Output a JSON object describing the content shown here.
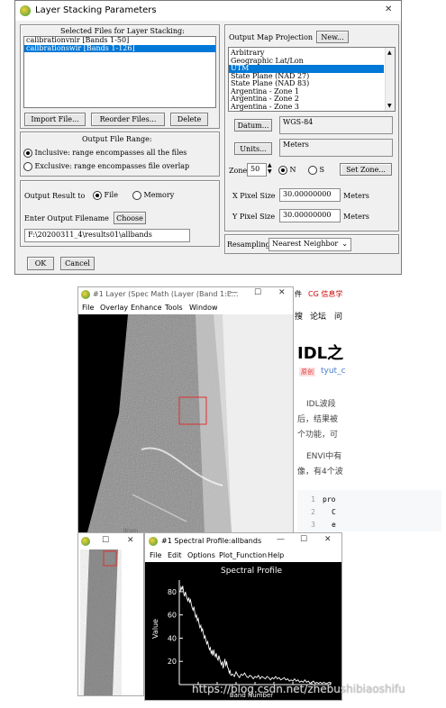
{
  "layer_dialog": {
    "title": "Layer Stacking Parameters",
    "close": "✕",
    "selected_files_label": "Selected Files for Layer Stacking:",
    "files": [
      "calibrationvnir [Bands 1-50]",
      "calibrationswir [Bands 1-126]"
    ],
    "import_btn": "Import File...",
    "reorder_btn": "Reorder Files...",
    "delete_btn": "Delete",
    "range_label": "Output File Range:",
    "inclusive": "Inclusive: range encompasses all the files",
    "exclusive": "Exclusive: range encompasses file overlap",
    "output_result_to": "Output Result to",
    "file_opt": "File",
    "memory_opt": "Memory",
    "filename_label": "Enter Output Filename",
    "choose_btn": "Choose",
    "filename_value": "F:\\20200311_4\\results01\\allbands",
    "ok_btn": "OK",
    "cancel_btn": "Cancel",
    "projection_label": "Output Map Projection",
    "new_btn": "New...",
    "projections": [
      "Arbitrary",
      "Geographic Lat/Lon",
      "UTM",
      "State Plane (NAD 27)",
      "State Plane (NAD 83)",
      "Argentina - Zone 1",
      "Argentina - Zone 2",
      "Argentina - Zone 3"
    ],
    "selected_projection": "UTM",
    "datum_btn": "Datum...",
    "datum_value": "WGS-84",
    "units_btn": "Units...",
    "units_value": "Meters",
    "zone_label": "Zone",
    "zone_value": "50",
    "n_opt": "N",
    "s_opt": "S",
    "set_zone_btn": "Set Zone...",
    "xpixel_label": "X Pixel Size",
    "xpixel_value": "30.00000000",
    "ypixel_label": "Y Pixel Size",
    "ypixel_value": "30.00000000",
    "meters": "Meters",
    "resampling_label": "Resampling",
    "resampling_value": "Nearest Neighbor"
  },
  "image_window": {
    "title": "#1 Layer (Spec Math (Layer (Band 1:E...",
    "menus": [
      "File",
      "Overlay",
      "Enhance",
      "Tools",
      "Window"
    ],
    "minimize": "—",
    "maximize": "☐",
    "close": "✕"
  },
  "bg_page": {
    "top_partial": "件",
    "cg": "CG 信息学",
    "nav_tail": "搜",
    "nav": [
      "论坛",
      "问"
    ],
    "heading": "IDL之",
    "tag": "原创",
    "author": "tyut_c",
    "para1": [
      "IDL波段",
      "后，结果被",
      "个功能，可"
    ],
    "para2": [
      "ENVI中有",
      "像，有4个波"
    ],
    "code_lines": [
      {
        "n": "1",
        "t": "pro"
      },
      {
        "n": "2",
        "t": "C"
      },
      {
        "n": "3",
        "t": "e"
      }
    ]
  },
  "scroll_window": {
    "title_partial": "",
    "max": "☐",
    "close": "✕",
    "label_partial": "itrum"
  },
  "spectral_window": {
    "title": "#1 Spectral Profile:allbands",
    "minimize": "—",
    "maximize": "☐",
    "close": "✕",
    "menus": [
      "File",
      "Edit",
      "Options",
      "Plot_Function",
      "Help"
    ]
  },
  "chart_data": {
    "type": "line",
    "title": "Spectral Profile",
    "xlabel": "Band Number",
    "ylabel": "Value",
    "yticks": [
      20,
      40,
      60,
      80
    ],
    "xticks": [],
    "ylim": [
      0,
      90
    ],
    "xlim": [
      0,
      176
    ],
    "series": [
      {
        "values": [
          [
            1,
            80
          ],
          [
            2,
            84
          ],
          [
            3,
            82
          ],
          [
            4,
            85
          ],
          [
            5,
            79
          ],
          [
            6,
            76
          ],
          [
            7,
            80
          ],
          [
            8,
            77
          ],
          [
            9,
            74
          ],
          [
            10,
            72
          ],
          [
            11,
            75
          ],
          [
            12,
            71
          ],
          [
            13,
            73
          ],
          [
            14,
            69
          ],
          [
            15,
            66
          ],
          [
            16,
            64
          ],
          [
            17,
            67
          ],
          [
            18,
            62
          ],
          [
            19,
            58
          ],
          [
            20,
            60
          ],
          [
            21,
            55
          ],
          [
            22,
            57
          ],
          [
            23,
            52
          ],
          [
            24,
            49
          ],
          [
            25,
            51
          ],
          [
            26,
            46
          ],
          [
            27,
            48
          ],
          [
            28,
            44
          ],
          [
            29,
            40
          ],
          [
            30,
            42
          ],
          [
            31,
            38
          ],
          [
            32,
            35
          ],
          [
            33,
            37
          ],
          [
            34,
            33
          ],
          [
            35,
            30
          ],
          [
            36,
            32
          ],
          [
            37,
            27
          ],
          [
            38,
            29
          ],
          [
            39,
            25
          ],
          [
            40,
            30
          ],
          [
            41,
            26
          ],
          [
            42,
            24
          ],
          [
            43,
            27
          ],
          [
            44,
            23
          ],
          [
            45,
            21
          ],
          [
            46,
            25
          ],
          [
            47,
            22
          ],
          [
            48,
            19
          ],
          [
            49,
            17
          ],
          [
            50,
            20
          ],
          [
            51,
            14
          ],
          [
            52,
            18
          ],
          [
            53,
            22
          ],
          [
            54,
            16
          ],
          [
            55,
            20
          ],
          [
            56,
            15
          ],
          [
            57,
            14
          ],
          [
            58,
            10
          ],
          [
            59,
            12
          ],
          [
            60,
            8
          ],
          [
            62,
            9
          ],
          [
            64,
            7
          ],
          [
            66,
            11
          ],
          [
            68,
            8
          ],
          [
            70,
            6
          ],
          [
            72,
            9
          ],
          [
            74,
            8
          ],
          [
            76,
            10
          ],
          [
            78,
            7
          ],
          [
            80,
            6
          ],
          [
            82,
            8
          ],
          [
            84,
            7
          ],
          [
            86,
            5
          ],
          [
            88,
            7
          ],
          [
            90,
            6
          ],
          [
            92,
            8
          ],
          [
            94,
            5
          ],
          [
            96,
            7
          ],
          [
            98,
            6
          ],
          [
            100,
            5
          ],
          [
            102,
            7
          ],
          [
            104,
            6
          ],
          [
            106,
            4
          ],
          [
            108,
            6
          ],
          [
            110,
            5
          ],
          [
            112,
            7
          ],
          [
            114,
            5
          ],
          [
            116,
            6
          ],
          [
            118,
            4
          ],
          [
            120,
            5
          ],
          [
            122,
            6
          ],
          [
            124,
            4
          ],
          [
            126,
            5
          ],
          [
            128,
            3
          ],
          [
            130,
            4
          ],
          [
            132,
            3
          ],
          [
            134,
            5
          ],
          [
            136,
            3
          ],
          [
            138,
            4
          ],
          [
            140,
            2
          ],
          [
            142,
            3
          ],
          [
            144,
            2
          ],
          [
            146,
            4
          ],
          [
            148,
            2
          ],
          [
            150,
            3
          ],
          [
            152,
            1
          ],
          [
            154,
            2
          ],
          [
            156,
            3
          ],
          [
            158,
            1
          ],
          [
            160,
            2
          ],
          [
            162,
            1
          ],
          [
            164,
            2
          ],
          [
            166,
            1
          ],
          [
            168,
            2
          ],
          [
            170,
            1
          ],
          [
            172,
            1
          ],
          [
            174,
            2
          ],
          [
            176,
            1
          ]
        ]
      }
    ]
  },
  "watermark": "https://blog.csdn.net/zhebushibiaoshifu"
}
